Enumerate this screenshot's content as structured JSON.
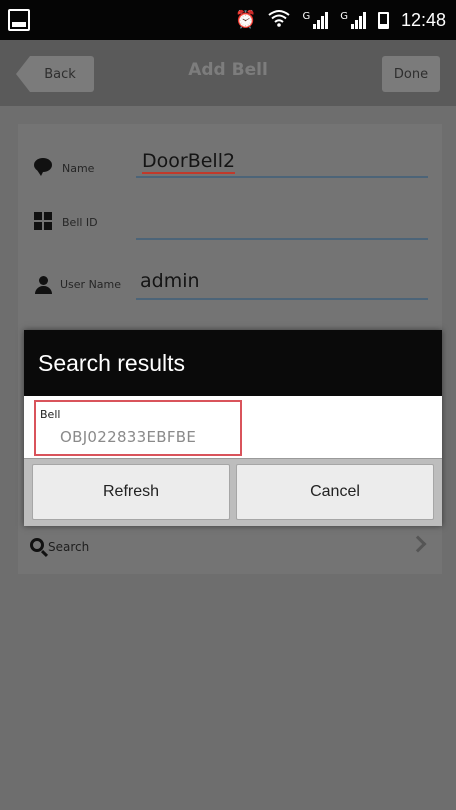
{
  "status_bar": {
    "time": "12:48",
    "signal_1_label": "G",
    "signal_2_label": "G"
  },
  "nav": {
    "back_label": "Back",
    "title": "Add Bell",
    "done_label": "Done"
  },
  "form": {
    "name_label": "Name",
    "name_value": "DoorBell2",
    "bell_id_label": "Bell ID",
    "bell_id_value": "",
    "user_name_label": "User Name",
    "user_name_value": "admin",
    "search_label": "Search"
  },
  "dialog": {
    "title": "Search results",
    "results": [
      {
        "label": "Bell",
        "value": "OBJ022833EBFBE"
      }
    ],
    "refresh_label": "Refresh",
    "cancel_label": "Cancel"
  },
  "icons": [
    "alarm-icon",
    "wifi-icon",
    "signal-icon",
    "battery-icon",
    "chat-bubble-icon",
    "grid-icon",
    "person-icon",
    "search-icon",
    "chevron-right-icon"
  ]
}
